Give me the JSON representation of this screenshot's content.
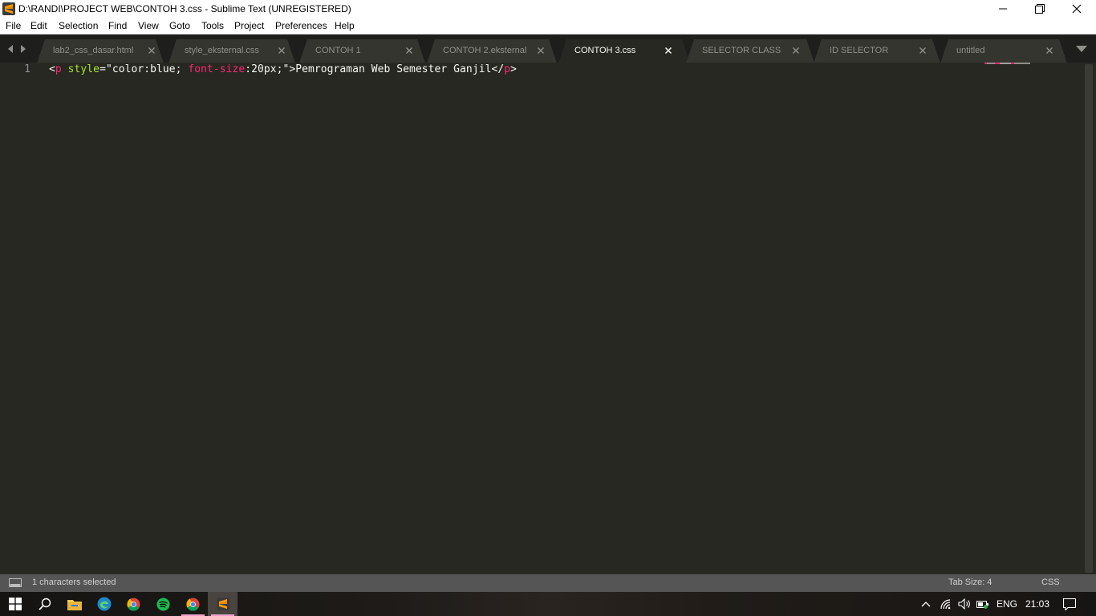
{
  "window": {
    "title": "D:\\RANDI\\PROJECT WEB\\CONTOH 3.css - Sublime Text (UNREGISTERED)",
    "app_icon": "sublime-text-icon",
    "controls": [
      "minimize-icon",
      "maximize-icon",
      "close-icon"
    ]
  },
  "menu": {
    "items": [
      "File",
      "Edit",
      "Selection",
      "Find",
      "View",
      "Goto",
      "Tools",
      "Project",
      "Preferences",
      "Help"
    ]
  },
  "tabs": [
    {
      "label": "lab2_css_dasar.html",
      "active": false
    },
    {
      "label": "style_eksternal.css",
      "active": false
    },
    {
      "label": "CONTOH 1",
      "active": false
    },
    {
      "label": "CONTOH 2.eksternal",
      "active": false
    },
    {
      "label": "CONTOH 3.css",
      "active": true
    },
    {
      "label": "SELECTOR CLASS",
      "active": false
    },
    {
      "label": "ID SELECTOR",
      "active": false
    },
    {
      "label": "untitled",
      "active": false
    }
  ],
  "editor": {
    "lines": [
      {
        "number": "1",
        "tokens": [
          {
            "text": "<",
            "kind": "punct"
          },
          {
            "text": "p",
            "kind": "tag"
          },
          {
            "text": " ",
            "kind": "plain"
          },
          {
            "text": "style",
            "kind": "attr"
          },
          {
            "text": "=",
            "kind": "plain"
          },
          {
            "text": "\"color:blue; ",
            "kind": "plain"
          },
          {
            "text": "font-size",
            "kind": "prop"
          },
          {
            "text": ":20px;\"",
            "kind": "plain"
          },
          {
            "text": ">Pemrograman Web Semester Ganjil</",
            "kind": "plain"
          },
          {
            "text": "p",
            "kind": "tag"
          },
          {
            "text": ">",
            "kind": "plain"
          }
        ]
      }
    ]
  },
  "status": {
    "selection": "1 characters selected",
    "tab_size": "Tab Size: 4",
    "syntax": "CSS"
  },
  "taskbar": {
    "apps": [
      "windows-start-icon",
      "search-icon",
      "file-explorer-icon",
      "edge-icon",
      "chrome-icon",
      "spotify-icon",
      "chrome-profile-icon",
      "sublime-text-icon"
    ],
    "language": "ENG",
    "time": "21:03"
  },
  "colors": {
    "editor_bg": "#272822",
    "tag": "#f92672",
    "attr": "#a6e22e",
    "text": "#f8f8f2",
    "statusbar": "#555555"
  }
}
